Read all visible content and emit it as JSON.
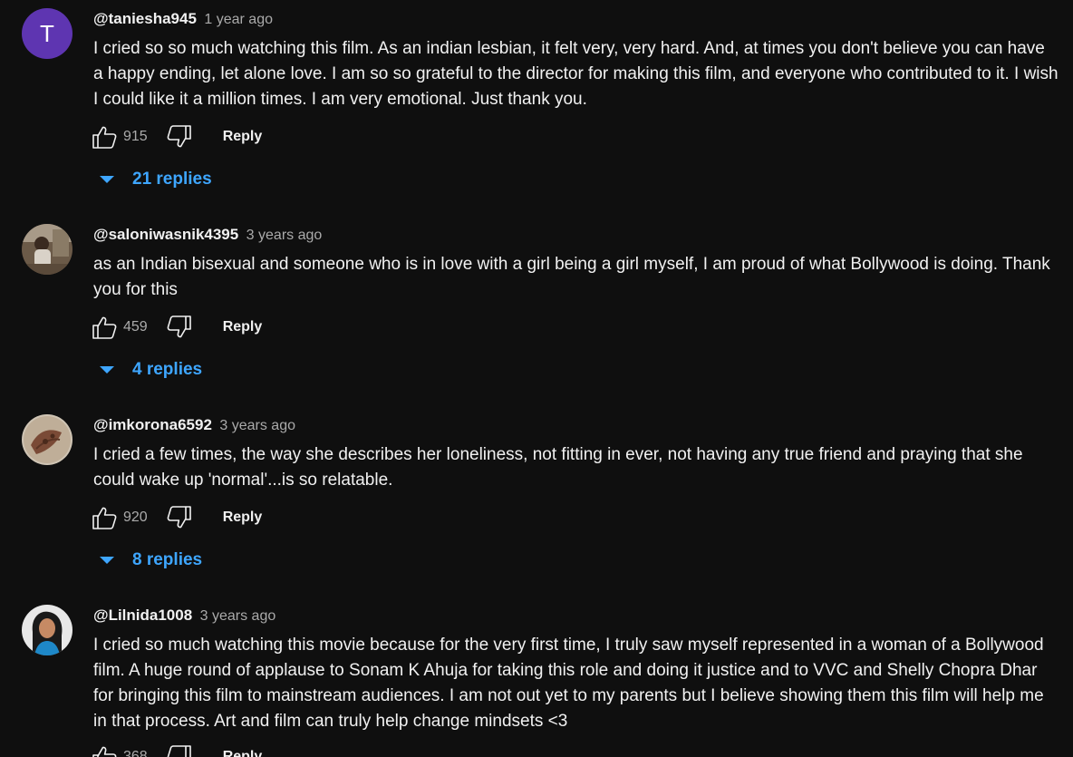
{
  "comments": [
    {
      "author": "@taniesha945",
      "time": "1 year ago",
      "avatar_letter": "T",
      "text": "I cried so so much watching this film. As an indian lesbian, it felt very, very hard. And, at times you don't believe you can have a happy ending, let alone love.  I am so so grateful to the director for making this film, and everyone who contributed to it. I wish I could like it a million times. I am very emotional. Just thank you.",
      "likes": "915",
      "reply_label": "Reply",
      "replies": "21 replies"
    },
    {
      "author": "@saloniwasnik4395",
      "time": "3 years ago",
      "text": "as an Indian bisexual and someone who is in love with a girl being a girl myself, I am proud of what Bollywood is doing. Thank you for this",
      "likes": "459",
      "reply_label": "Reply",
      "replies": "4 replies"
    },
    {
      "author": "@imkorona6592",
      "time": "3 years ago",
      "text": "I cried a few times, the way she describes her loneliness, not fitting in ever, not having any true friend and praying that she could wake up 'normal'...is so relatable.",
      "likes": "920",
      "reply_label": "Reply",
      "replies": "8 replies"
    },
    {
      "author": "@Lilnida1008",
      "time": "3 years ago",
      "text": "I cried so much watching this movie because for the very first time, I truly saw myself represented in a woman of a Bollywood film. A huge round of applause to Sonam K Ahuja for taking this role and doing it justice and to VVC and Shelly Chopra Dhar for bringing this film to mainstream audiences. I am not out yet to my parents but I believe showing them this film will help me in that process. Art and film can truly help change mindsets <3",
      "likes": "368",
      "reply_label": "Reply"
    }
  ],
  "colors": {
    "background": "#0f0f0f",
    "text": "#f1f1f1",
    "secondary_text": "#aaaaaa",
    "link_blue": "#3ea6ff",
    "avatar_purple": "#5e35b1"
  },
  "icons": [
    "like-icon",
    "dislike-icon",
    "chevron-down-icon"
  ]
}
